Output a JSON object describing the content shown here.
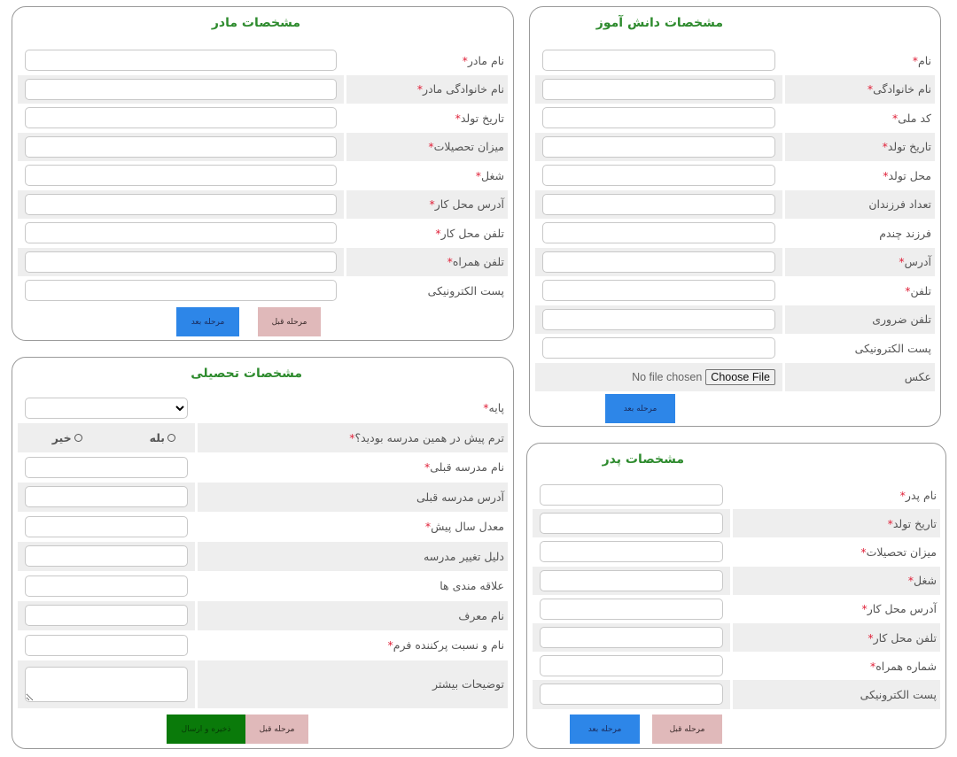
{
  "student": {
    "title": "مشخصات دانش آموز",
    "fields": [
      {
        "label": "نام",
        "required": true,
        "type": "text"
      },
      {
        "label": "نام خانوادگی",
        "required": true,
        "type": "text"
      },
      {
        "label": "کد ملی",
        "required": true,
        "type": "text"
      },
      {
        "label": "تاریخ تولد",
        "required": true,
        "type": "text"
      },
      {
        "label": "محل تولد",
        "required": true,
        "type": "text"
      },
      {
        "label": "تعداد فرزندان",
        "required": false,
        "type": "text"
      },
      {
        "label": "فرزند چندم",
        "required": false,
        "type": "text"
      },
      {
        "label": "آدرس",
        "required": true,
        "type": "text"
      },
      {
        "label": "تلفن",
        "required": true,
        "type": "text"
      },
      {
        "label": "تلفن ضروری",
        "required": false,
        "type": "text"
      },
      {
        "label": "پست الکترونیکی",
        "required": false,
        "type": "text"
      },
      {
        "label": "عکس",
        "required": false,
        "type": "file"
      }
    ],
    "file_button": "Choose File",
    "file_status": "No file chosen",
    "next_label": "مرحله بعد"
  },
  "mother": {
    "title": "مشخصات مادر",
    "fields": [
      {
        "label": "نام مادر",
        "required": true
      },
      {
        "label": "نام خانوادگی مادر",
        "required": true
      },
      {
        "label": "تاریخ تولد",
        "required": true
      },
      {
        "label": "میزان تحصیلات",
        "required": true
      },
      {
        "label": "شغل",
        "required": true
      },
      {
        "label": "آدرس محل کار",
        "required": true
      },
      {
        "label": "تلفن محل کار",
        "required": true
      },
      {
        "label": "تلفن همراه",
        "required": true
      },
      {
        "label": "پست الکترونیکی",
        "required": false
      }
    ],
    "prev_label": "مرحله قبل",
    "next_label": "مرحله بعد"
  },
  "father": {
    "title": "مشخصات پدر",
    "fields": [
      {
        "label": "نام پدر",
        "required": true
      },
      {
        "label": "تاریخ تولد",
        "required": true
      },
      {
        "label": "میزان تحصیلات",
        "required": true
      },
      {
        "label": "شغل",
        "required": true
      },
      {
        "label": "آدرس محل کار",
        "required": true
      },
      {
        "label": "تلفن محل کار",
        "required": true
      },
      {
        "label": "شماره همراه",
        "required": true
      },
      {
        "label": "پست الکترونیکی",
        "required": false
      }
    ],
    "prev_label": "مرحله قبل",
    "next_label": "مرحله بعد"
  },
  "education": {
    "title": "مشخصات تحصیلی",
    "fields": [
      {
        "label": "پایه",
        "required": true,
        "type": "select",
        "value": ""
      },
      {
        "label": "ترم پیش در همین مدرسه بودید؟",
        "required": true,
        "type": "radio",
        "options": [
          "بله",
          "خیر"
        ]
      },
      {
        "label": "نام مدرسه قبلی",
        "required": true,
        "type": "text"
      },
      {
        "label": "آدرس مدرسه قبلی",
        "required": false,
        "type": "text"
      },
      {
        "label": "معدل سال پیش",
        "required": true,
        "type": "text"
      },
      {
        "label": "دلیل تغییر مدرسه",
        "required": false,
        "type": "text"
      },
      {
        "label": "علاقه مندی ها",
        "required": false,
        "type": "text"
      },
      {
        "label": "نام معرف",
        "required": false,
        "type": "text"
      },
      {
        "label": "نام و نسبت پرکننده فرم",
        "required": true,
        "type": "text"
      },
      {
        "label": "توضیحات بیشتر",
        "required": false,
        "type": "textarea"
      }
    ],
    "prev_label": "مرحله قبل",
    "save_label": "ذخیره و ارسال"
  },
  "required_marker": "*",
  "colors": {
    "title_green": "#2e8b2e",
    "required_red": "#e0223a",
    "next_blue": "#2d86e8",
    "prev_pink": "#e0b9ba",
    "save_green": "#0a7a0a",
    "row_alt_gray": "#eeeeee"
  }
}
